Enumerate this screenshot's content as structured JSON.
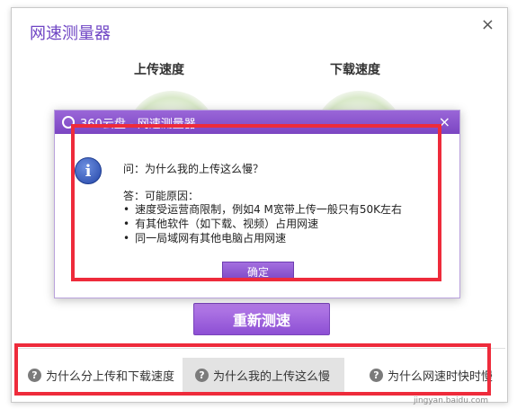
{
  "window": {
    "title": "网速测量器",
    "close_glyph": "×"
  },
  "gauges": {
    "upload_label": "上传速度",
    "download_label": "下载速度"
  },
  "retest_button": "重新测速",
  "tabs": [
    {
      "label": "为什么分上传和下载速度",
      "icon": "question-icon"
    },
    {
      "label": "为什么我的上传这么慢",
      "icon": "question-icon",
      "active": true
    },
    {
      "label": "为什么网速时快时慢",
      "icon": "question-icon"
    }
  ],
  "dialog": {
    "title": "360云盘 - 网速测量器",
    "close_glyph": "×",
    "info_glyph": "i",
    "question": "问：为什么我的上传这么慢？",
    "answer_label": "答：可能原因：",
    "reasons": [
      "速度受运营商限制，例如4 M宽带上传一般只有50K左右",
      "有其他软件（如下载、视频）占用网速",
      "同一局域网有其他电脑占用网速"
    ],
    "ok_button": "确定"
  },
  "watermark": "jingyan.baidu.com",
  "colors": {
    "accent": "#7b45c2",
    "highlight": "#ee2b3b"
  }
}
